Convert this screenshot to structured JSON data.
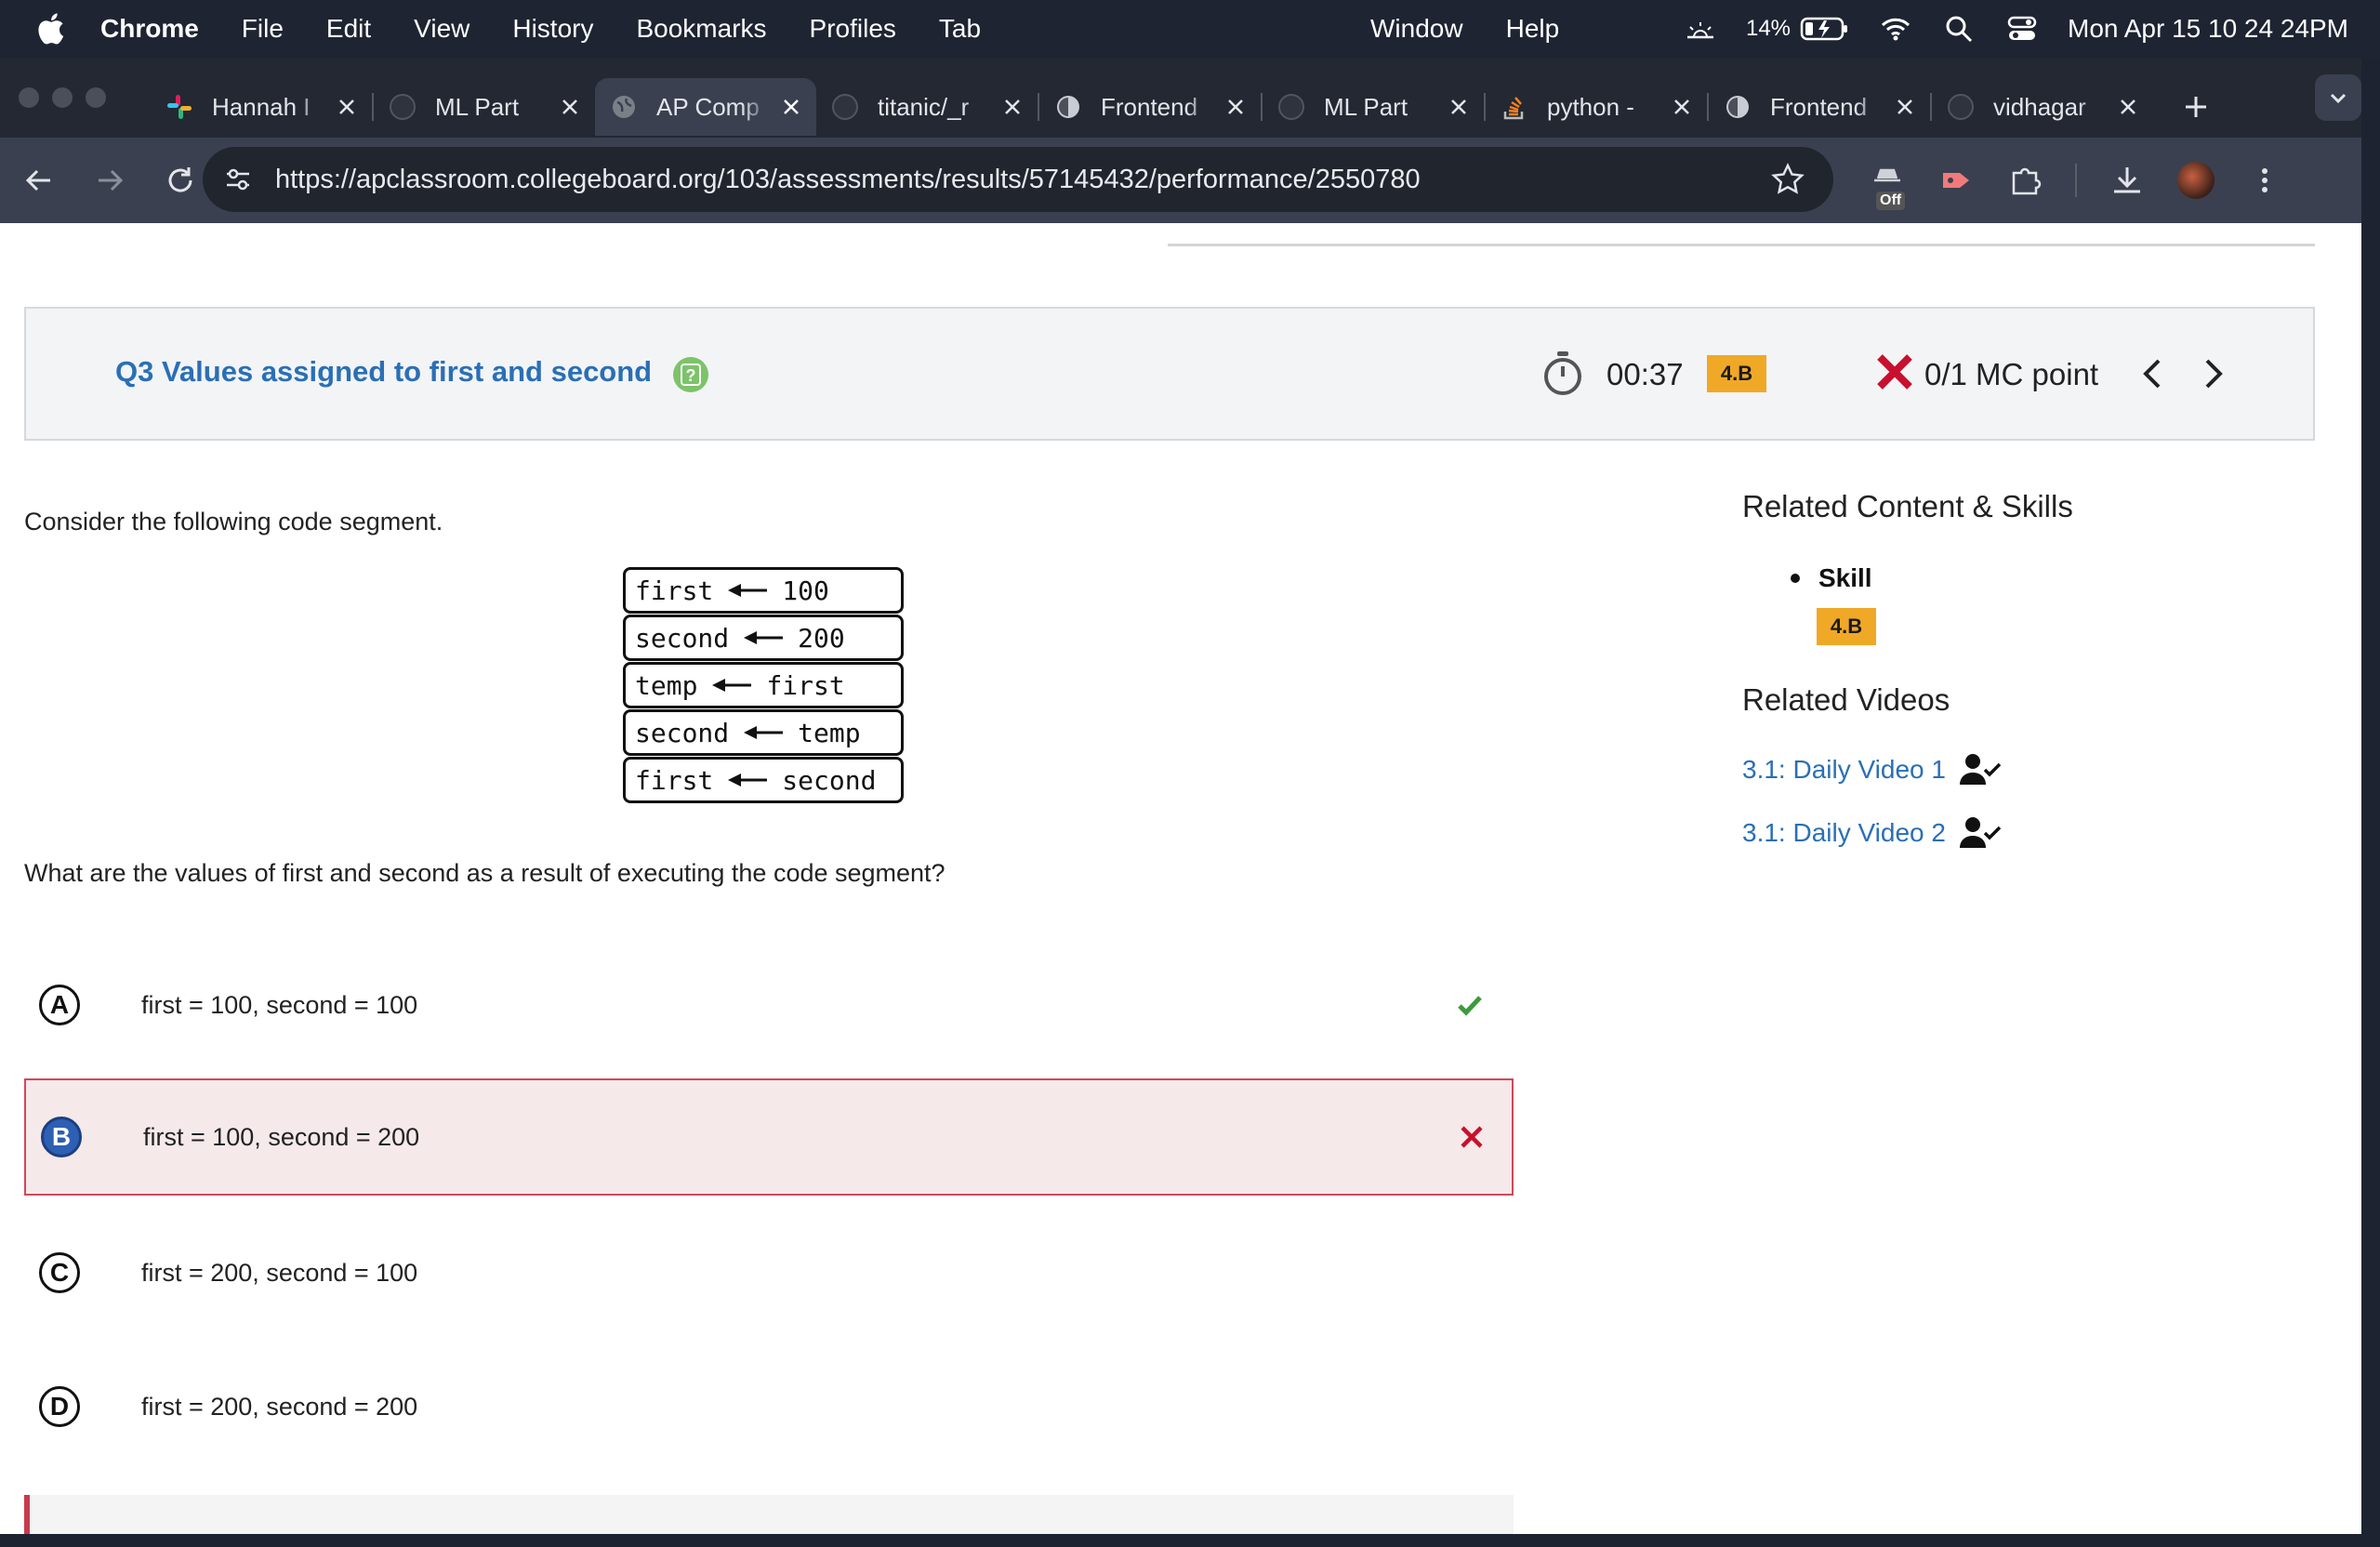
{
  "menubar": {
    "app": "Chrome",
    "items": [
      "File",
      "Edit",
      "View",
      "History",
      "Bookmarks",
      "Profiles",
      "Tab"
    ],
    "items_right": [
      "Window",
      "Help"
    ],
    "battery": "14%",
    "datetime": "Mon Apr 15  10 24 24PM"
  },
  "tabs": [
    {
      "label": "Hannah I",
      "icon": "slack-icon",
      "active": false
    },
    {
      "label": "ML Part",
      "icon": "github-icon",
      "active": false
    },
    {
      "label": "AP Comp",
      "icon": "globe-icon",
      "active": true
    },
    {
      "label": "titanic/_r",
      "icon": "github-icon",
      "active": false
    },
    {
      "label": "Frontend",
      "icon": "site-icon",
      "active": false
    },
    {
      "label": "ML Part",
      "icon": "github-icon",
      "active": false
    },
    {
      "label": "python -",
      "icon": "stackoverflow-icon",
      "active": false
    },
    {
      "label": "Frontend",
      "icon": "site-icon",
      "active": false
    },
    {
      "label": "vidhagar",
      "icon": "github-icon",
      "active": false
    }
  ],
  "address_bar": {
    "url": "https://apclassroom.collegeboard.org/103/assessments/results/57145432/performance/2550780"
  },
  "toolbar": {
    "extension_badge": "Off"
  },
  "question_header": {
    "title": "Q3 Values assigned to first and second",
    "time": "00:37",
    "skill": "4.B",
    "score": "0/1 MC point"
  },
  "question": {
    "stem": "Consider the following code segment.",
    "code": [
      {
        "left": "first",
        "right": "100"
      },
      {
        "left": "second",
        "right": "200"
      },
      {
        "left": "temp",
        "right": "first"
      },
      {
        "left": "second",
        "right": "temp"
      },
      {
        "left": "first",
        "right": "second"
      }
    ],
    "prompt": "What are the values of first and second as a result of executing the code segment?",
    "choices": [
      {
        "letter": "A",
        "text": "first = 100, second = 100",
        "status": "correct"
      },
      {
        "letter": "B",
        "text": "first = 100, second = 200",
        "status": "selected-wrong"
      },
      {
        "letter": "C",
        "text": "first = 200, second = 100",
        "status": "none"
      },
      {
        "letter": "D",
        "text": "first = 200, second = 200",
        "status": "none"
      }
    ]
  },
  "sidebar": {
    "related_heading": "Related Content & Skills",
    "skill_label": "Skill",
    "skill_badge": "4.B",
    "videos_heading": "Related Videos",
    "videos": [
      "3.1: Daily Video 1",
      "3.1: Daily Video 2"
    ]
  },
  "colors": {
    "accent_link": "#2a6fb5",
    "skill_badge": "#f0a827",
    "wrong": "#c8102e",
    "correct": "#3d9a3d"
  }
}
